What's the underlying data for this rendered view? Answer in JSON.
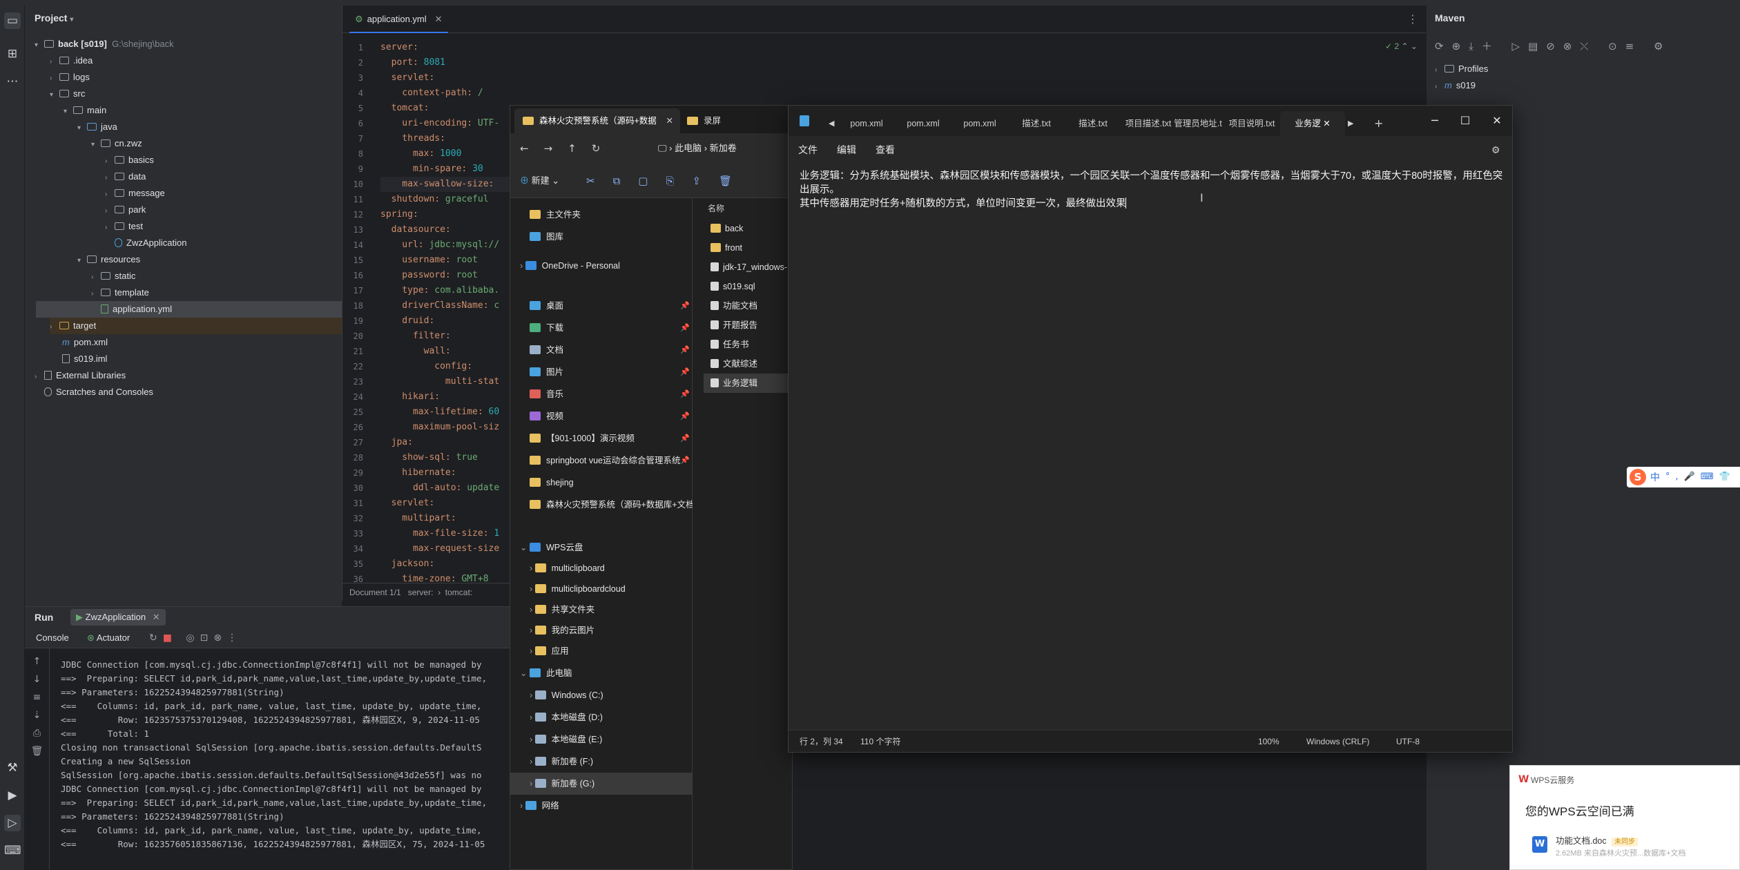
{
  "project": {
    "title": "Project",
    "root_name": "back [s019]",
    "root_path": "G:\\shejing\\back",
    "tree": [
      ".idea",
      "logs",
      "src",
      "main",
      "java",
      "cn.zwz",
      "basics",
      "data",
      "message",
      "park",
      "test",
      "ZwzApplication",
      "resources",
      "static",
      "template",
      "application.yml",
      "target",
      "pom.xml",
      "s019.iml",
      "External Libraries",
      "Scratches and Consoles"
    ]
  },
  "editor": {
    "tab_label": "application.yml",
    "warnings": "2",
    "breadcrumb": [
      "Document 1/1",
      "server:",
      "tomcat:"
    ],
    "lines": [
      {
        "n": "1",
        "k": "server:",
        "v": ""
      },
      {
        "n": "2",
        "k": "  port: ",
        "v": "8081"
      },
      {
        "n": "3",
        "k": "  servlet:",
        "v": ""
      },
      {
        "n": "4",
        "k": "    context-path: ",
        "v": "/"
      },
      {
        "n": "5",
        "k": "  tomcat:",
        "v": ""
      },
      {
        "n": "6",
        "k": "    uri-encoding: ",
        "v": "UTF-"
      },
      {
        "n": "7",
        "k": "    threads:",
        "v": ""
      },
      {
        "n": "8",
        "k": "      max: ",
        "v": "1000"
      },
      {
        "n": "9",
        "k": "      min-spare: ",
        "v": "30"
      },
      {
        "n": "10",
        "k": "    max-swallow-size: ",
        "v": ""
      },
      {
        "n": "11",
        "k": "  shutdown: ",
        "v": "graceful"
      },
      {
        "n": "12",
        "k": "spring:",
        "v": ""
      },
      {
        "n": "13",
        "k": "  datasource:",
        "v": ""
      },
      {
        "n": "14",
        "k": "    url: ",
        "v": "jdbc:mysql://"
      },
      {
        "n": "15",
        "k": "    username: ",
        "v": "root"
      },
      {
        "n": "16",
        "k": "    password: ",
        "v": "root"
      },
      {
        "n": "17",
        "k": "    type: ",
        "v": "com.alibaba."
      },
      {
        "n": "18",
        "k": "    driverClassName: ",
        "v": "c"
      },
      {
        "n": "19",
        "k": "    druid:",
        "v": ""
      },
      {
        "n": "20",
        "k": "      filter:",
        "v": ""
      },
      {
        "n": "21",
        "k": "        wall:",
        "v": ""
      },
      {
        "n": "22",
        "k": "          config:",
        "v": ""
      },
      {
        "n": "23",
        "k": "            multi-stat",
        "v": ""
      },
      {
        "n": "24",
        "k": "    hikari:",
        "v": ""
      },
      {
        "n": "25",
        "k": "      max-lifetime: ",
        "v": "60"
      },
      {
        "n": "26",
        "k": "      maximum-pool-siz",
        "v": ""
      },
      {
        "n": "27",
        "k": "  jpa:",
        "v": ""
      },
      {
        "n": "28",
        "k": "    show-sql: ",
        "v": "true"
      },
      {
        "n": "29",
        "k": "    hibernate:",
        "v": ""
      },
      {
        "n": "30",
        "k": "      ddl-auto: ",
        "v": "update"
      },
      {
        "n": "31",
        "k": "  servlet:",
        "v": ""
      },
      {
        "n": "32",
        "k": "    multipart:",
        "v": ""
      },
      {
        "n": "33",
        "k": "      max-file-size: ",
        "v": "1"
      },
      {
        "n": "34",
        "k": "      max-request-size",
        "v": ""
      },
      {
        "n": "35",
        "k": "  jackson:",
        "v": ""
      },
      {
        "n": "36",
        "k": "    time-zone: ",
        "v": "GMT+8"
      }
    ]
  },
  "maven": {
    "title": "Maven",
    "items": [
      "Profiles",
      "s019"
    ]
  },
  "run": {
    "tab_run": "Run",
    "tab_app": "ZwzApplication",
    "sub_console": "Console",
    "sub_actuator": "Actuator",
    "log": [
      "JDBC Connection [com.mysql.cj.jdbc.ConnectionImpl@7c8f4f1] will not be managed by",
      "==>  Preparing: SELECT id,park_id,park_name,value,last_time,update_by,update_time,",
      "==> Parameters: 1622524394825977881(String)",
      "<==    Columns: id, park_id, park_name, value, last_time, update_by, update_time,",
      "<==        Row: 1623575375370129408, 1622524394825977881, 森林园区X, 9, 2024-11-05",
      "<==      Total: 1",
      "Closing non transactional SqlSession [org.apache.ibatis.session.defaults.DefaultS",
      "Creating a new SqlSession",
      "SqlSession [org.apache.ibatis.session.defaults.DefaultSqlSession@43d2e55f] was no",
      "JDBC Connection [com.mysql.cj.jdbc.ConnectionImpl@7c8f4f1] will not be managed by",
      "==>  Preparing: SELECT id,park_id,park_name,value,last_time,update_by,update_time,",
      "==> Parameters: 1622524394825977881(String)",
      "<==    Columns: id, park_id, park_name, value, last_time, update_by, update_time,",
      "<==        Row: 1623576051835867136, 1622524394825977881, 森林园区X, 75, 2024-11-05"
    ]
  },
  "explorer": {
    "tab_title": "森林火灾预警系统（源码+数据",
    "tab2_title": "录屏",
    "address": [
      "此电脑",
      "新加卷"
    ],
    "new_label": "新建",
    "column_name": "名称",
    "nav": [
      {
        "label": "主文件夹",
        "color": "#e8c060",
        "pin": false
      },
      {
        "label": "图库",
        "color": "#4aa3df",
        "pin": false
      },
      {
        "label": "OneDrive - Personal",
        "color": "#3a8de0",
        "pin": false
      },
      {
        "label": "桌面",
        "color": "#4aa3df",
        "pin": true
      },
      {
        "label": "下载",
        "color": "#4caf7d",
        "pin": true
      },
      {
        "label": "文档",
        "color": "#9ab0c8",
        "pin": true
      },
      {
        "label": "图片",
        "color": "#4aa3df",
        "pin": true
      },
      {
        "label": "音乐",
        "color": "#e0605a",
        "pin": true
      },
      {
        "label": "视频",
        "color": "#9b6ad6",
        "pin": true
      },
      {
        "label": "【901-1000】演示视频",
        "color": "#e8c060",
        "pin": true
      },
      {
        "label": "springboot vue运动会综合管理系统",
        "color": "#e8c060",
        "pin": true
      },
      {
        "label": "shejing",
        "color": "#e8c060",
        "pin": false
      },
      {
        "label": "森林火灾预警系统（源码+数据库+文档",
        "color": "#e8c060",
        "pin": false
      },
      {
        "label": "WPS云盘",
        "color": "#3a8de0",
        "pin": false
      },
      {
        "label": "multiclipboard",
        "color": "#e8c060",
        "pin": false
      },
      {
        "label": "multiclipboardcloud",
        "color": "#e8c060",
        "pin": false
      },
      {
        "label": "共享文件夹",
        "color": "#e8c060",
        "pin": false
      },
      {
        "label": "我的云图片",
        "color": "#e8c060",
        "pin": false
      },
      {
        "label": "应用",
        "color": "#e8c060",
        "pin": false
      },
      {
        "label": "此电脑",
        "color": "#4aa3df",
        "pin": false
      },
      {
        "label": "Windows (C:)",
        "color": "#9ab0c8",
        "pin": false
      },
      {
        "label": "本地磁盘 (D:)",
        "color": "#9ab0c8",
        "pin": false
      },
      {
        "label": "本地磁盘 (E:)",
        "color": "#9ab0c8",
        "pin": false
      },
      {
        "label": "新加卷 (F:)",
        "color": "#9ab0c8",
        "pin": false
      },
      {
        "label": "新加卷 (G:)",
        "color": "#9ab0c8",
        "pin": false
      },
      {
        "label": "网络",
        "color": "#4aa3df",
        "pin": false
      }
    ],
    "files": [
      "back",
      "front",
      "jdk-17_windows-",
      "s019.sql",
      "功能文档",
      "开题报告",
      "任务书",
      "文献综述",
      "业务逻辑"
    ]
  },
  "notepad": {
    "tabs": [
      "pom.xml",
      "pom.xml",
      "pom.xml",
      "描述.txt",
      "描述.txt",
      "项目描述.txt",
      "管理员地址.t",
      "项目说明.txt",
      "业务逻"
    ],
    "menu": [
      "文件",
      "编辑",
      "查看"
    ],
    "text_line1": "业务逻辑：分为系统基础模块、森林园区模块和传感器模块，一个园区关联一个温度传感器和一个烟雾传感器，当烟雾大于70，或温度大于80时报警，用红色突出展示。",
    "text_line2": "其中传感器用定时任务+随机数的方式，单位时间变更一次，最终做出效果",
    "status_pos": "行 2，列 34",
    "status_count": "110 个字符",
    "status_zoom": "100%",
    "status_eol": "Windows (CRLF)",
    "status_enc": "UTF-8"
  },
  "wps": {
    "app": "WPS云服务",
    "message": "您的WPS云空间已满",
    "file_name": "功能文档.doc",
    "file_badge": "未同步",
    "file_meta": "2.62MB  来自森林火灾预...数据库+文档"
  },
  "ime": {
    "label": "中"
  },
  "colors": {
    "accent": "#3574f0",
    "ide_bg": "#1e1f22",
    "ide_panel": "#2b2d30",
    "keyword": "#cf8e6d",
    "string": "#6aab73"
  }
}
